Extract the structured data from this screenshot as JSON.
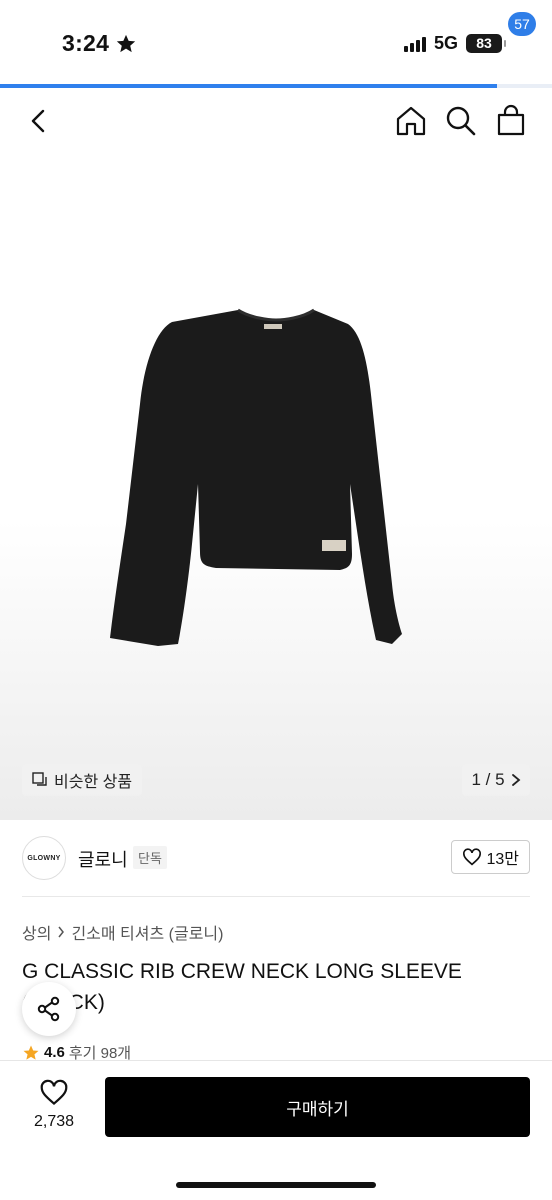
{
  "status": {
    "time": "3:24",
    "network": "5G",
    "battery": "83"
  },
  "page_progress": 0.9,
  "nav": {
    "cart_count": "57"
  },
  "gallery": {
    "similar_label": "비슷한 상품",
    "pager": "1 / 5"
  },
  "brand": {
    "logo_text": "GLOWNY",
    "name": "글로니",
    "tag": "단독",
    "likes": "13만"
  },
  "breadcrumb": {
    "category": "상의",
    "subcategory": "긴소매 티셔츠 (글로니)"
  },
  "product": {
    "title": "G CLASSIC RIB CREW NECK LONG SLEEVE (BLACK)",
    "rating": "4.6",
    "reviews": "후기 98개"
  },
  "bottom": {
    "wish_count": "2,738",
    "buy_label": "구매하기"
  },
  "colors": {
    "accent": "#2f80ed",
    "badge": "#2f7ee8",
    "star": "#f5a623",
    "buy_button": "#000000"
  },
  "icons": [
    "star-icon",
    "signal-icon",
    "battery-icon",
    "back-icon",
    "home-icon",
    "search-icon",
    "cart-icon",
    "similar-icon",
    "chevron-right-icon",
    "heart-icon",
    "share-icon"
  ]
}
